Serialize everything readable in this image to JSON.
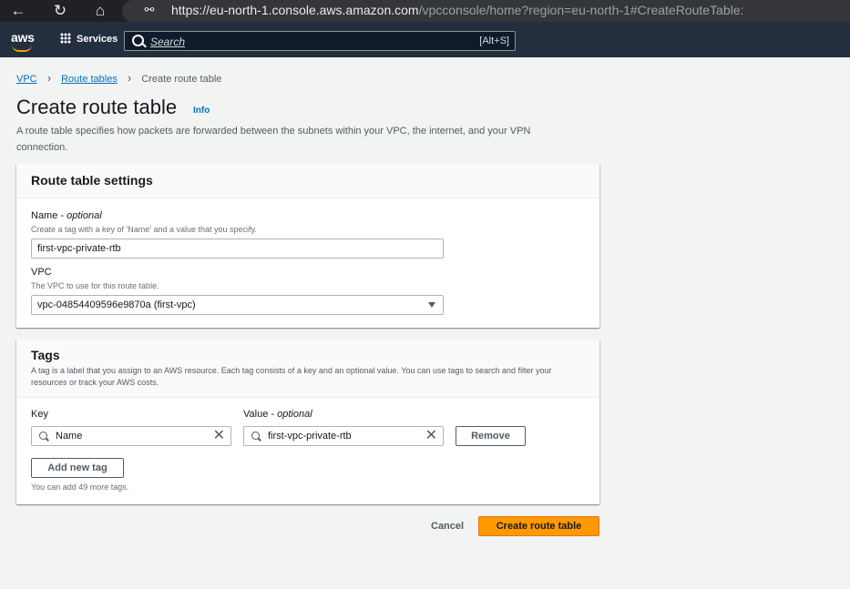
{
  "browser": {
    "url_host": "https://eu-north-1.console.aws.amazon.com",
    "url_path": "/vpcconsole/home?region=eu-north-1#CreateRouteTable:"
  },
  "nav": {
    "logo": "aws",
    "services_label": "Services",
    "search_placeholder": "Search",
    "search_shortcut": "[Alt+S]"
  },
  "breadcrumb": {
    "items": [
      "VPC",
      "Route tables"
    ],
    "current": "Create route table"
  },
  "page": {
    "title": "Create route table",
    "info_label": "Info",
    "description": "A route table specifies how packets are forwarded between the subnets within your VPC, the internet, and your VPN connection."
  },
  "settings": {
    "title": "Route table settings",
    "name_label": "Name",
    "name_optional": "optional",
    "name_help": "Create a tag with a key of 'Name' and a value that you specify.",
    "name_value": "first-vpc-private-rtb",
    "vpc_label": "VPC",
    "vpc_help": "The VPC to use for this route table.",
    "vpc_value": "vpc-04854409596e9870a (first-vpc)"
  },
  "tags": {
    "title": "Tags",
    "description": "A tag is a label that you assign to an AWS resource. Each tag consists of a key and an optional value. You can use tags to search and filter your resources or track your AWS costs.",
    "key_label": "Key",
    "value_label": "Value",
    "value_optional": "optional",
    "rows": [
      {
        "key": "Name",
        "value": "first-vpc-private-rtb"
      }
    ],
    "remove_label": "Remove",
    "add_label": "Add new tag",
    "limit_text": "You can add 49 more tags."
  },
  "actions": {
    "cancel_label": "Cancel",
    "create_label": "Create route table"
  },
  "colors": {
    "primary_button": "#ff9900",
    "nav_bg": "#232f3e",
    "link": "#0073bb"
  }
}
